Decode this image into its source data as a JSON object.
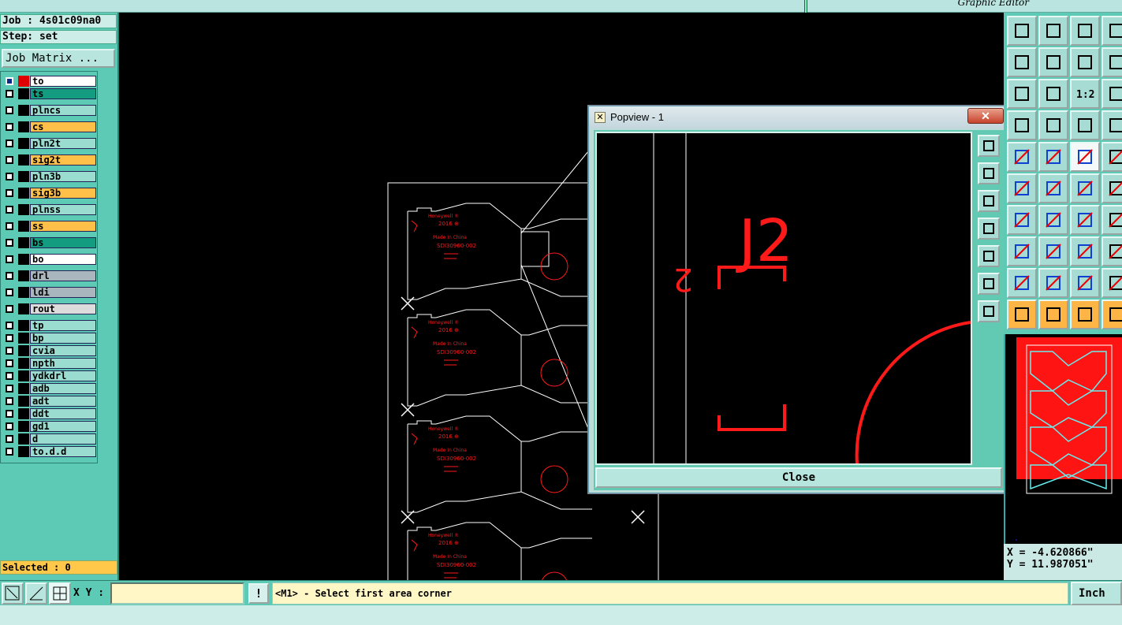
{
  "window": {
    "title": "Graphic Editor"
  },
  "job": {
    "job_label": "Job : 4s01c09na0",
    "step_label": "Step: set",
    "matrix_button": "Job Matrix ..."
  },
  "layers": [
    {
      "name": "to",
      "color": "#ffffff",
      "checked": true,
      "swatch": "#e00000"
    },
    {
      "name": "ts",
      "color": "#149c80",
      "checked": false,
      "swatch": "#000000"
    },
    {
      "name": "plncs",
      "color": "#9adcd0",
      "checked": false,
      "swatch": "#000000"
    },
    {
      "name": "cs",
      "color": "#ffc04a",
      "checked": false,
      "swatch": "#000000"
    },
    {
      "name": "pln2t",
      "color": "#9adcd0",
      "checked": false,
      "swatch": "#000000"
    },
    {
      "name": "sig2t",
      "color": "#ffc04a",
      "checked": false,
      "swatch": "#000000"
    },
    {
      "name": "pln3b",
      "color": "#9adcd0",
      "checked": false,
      "swatch": "#000000"
    },
    {
      "name": "sig3b",
      "color": "#ffc04a",
      "checked": false,
      "swatch": "#000000"
    },
    {
      "name": "plnss",
      "color": "#9adcd0",
      "checked": false,
      "swatch": "#000000"
    },
    {
      "name": "ss",
      "color": "#ffc04a",
      "checked": false,
      "swatch": "#000000"
    },
    {
      "name": "bs",
      "color": "#149c80",
      "checked": false,
      "swatch": "#000000"
    },
    {
      "name": "bo",
      "color": "#ffffff",
      "checked": false,
      "swatch": "#000000"
    },
    {
      "name": "drl",
      "color": "#a9b6bd",
      "checked": false,
      "swatch": "#000000"
    },
    {
      "name": "ldi",
      "color": "#a9b6bd",
      "checked": false,
      "swatch": "#000000"
    },
    {
      "name": "rout",
      "color": "#dcdcdc",
      "checked": false,
      "swatch": "#000000"
    },
    {
      "name": "tp",
      "color": "#9adcd0",
      "checked": false,
      "swatch": "#000000"
    },
    {
      "name": "bp",
      "color": "#9adcd0",
      "checked": false,
      "swatch": "#000000"
    },
    {
      "name": "cvia",
      "color": "#9adcd0",
      "checked": false,
      "swatch": "#000000"
    },
    {
      "name": "npth",
      "color": "#9adcd0",
      "checked": false,
      "swatch": "#000000"
    },
    {
      "name": "ydkdrl",
      "color": "#9adcd0",
      "checked": false,
      "swatch": "#000000"
    },
    {
      "name": "adb",
      "color": "#9adcd0",
      "checked": false,
      "swatch": "#000000"
    },
    {
      "name": "adt",
      "color": "#9adcd0",
      "checked": false,
      "swatch": "#000000"
    },
    {
      "name": "ddt",
      "color": "#9adcd0",
      "checked": false,
      "swatch": "#000000"
    },
    {
      "name": "gd1",
      "color": "#9adcd0",
      "checked": false,
      "swatch": "#000000"
    },
    {
      "name": "d",
      "color": "#9adcd0",
      "checked": false,
      "swatch": "#000000"
    },
    {
      "name": "to.d.d",
      "color": "#9adcd0",
      "checked": false,
      "swatch": "#000000"
    }
  ],
  "selected_label": "Selected : 0",
  "popview": {
    "title": "Popview - 1",
    "close_x": "✕",
    "close_button": "Close",
    "designator": "J2",
    "pin_label": "2",
    "tools": [
      "zoom-window-icon",
      "pan-up-icon",
      "pan-down-icon",
      "pan-left-icon",
      "pan-right-icon",
      "zoom-fit-icon",
      "zoom-home-icon"
    ]
  },
  "board": {
    "panel_texts": [
      "Honeywell ®",
      "2016 ⊕",
      "Made In China",
      "SDI30960-002"
    ]
  },
  "right_toolbar": {
    "zoom_ratio": "1:2"
  },
  "coords": {
    "x": "X = -4.620866\"",
    "y": "Y = 11.987051\""
  },
  "bottom": {
    "xy_label": "X Y :",
    "xy_value": "",
    "bang": "!",
    "message": "<M1> - Select first area corner",
    "units": "Inch"
  },
  "colors": {
    "panel": "#5ccab4",
    "trace": "#ff1a1a",
    "outline": "#ffffff"
  }
}
